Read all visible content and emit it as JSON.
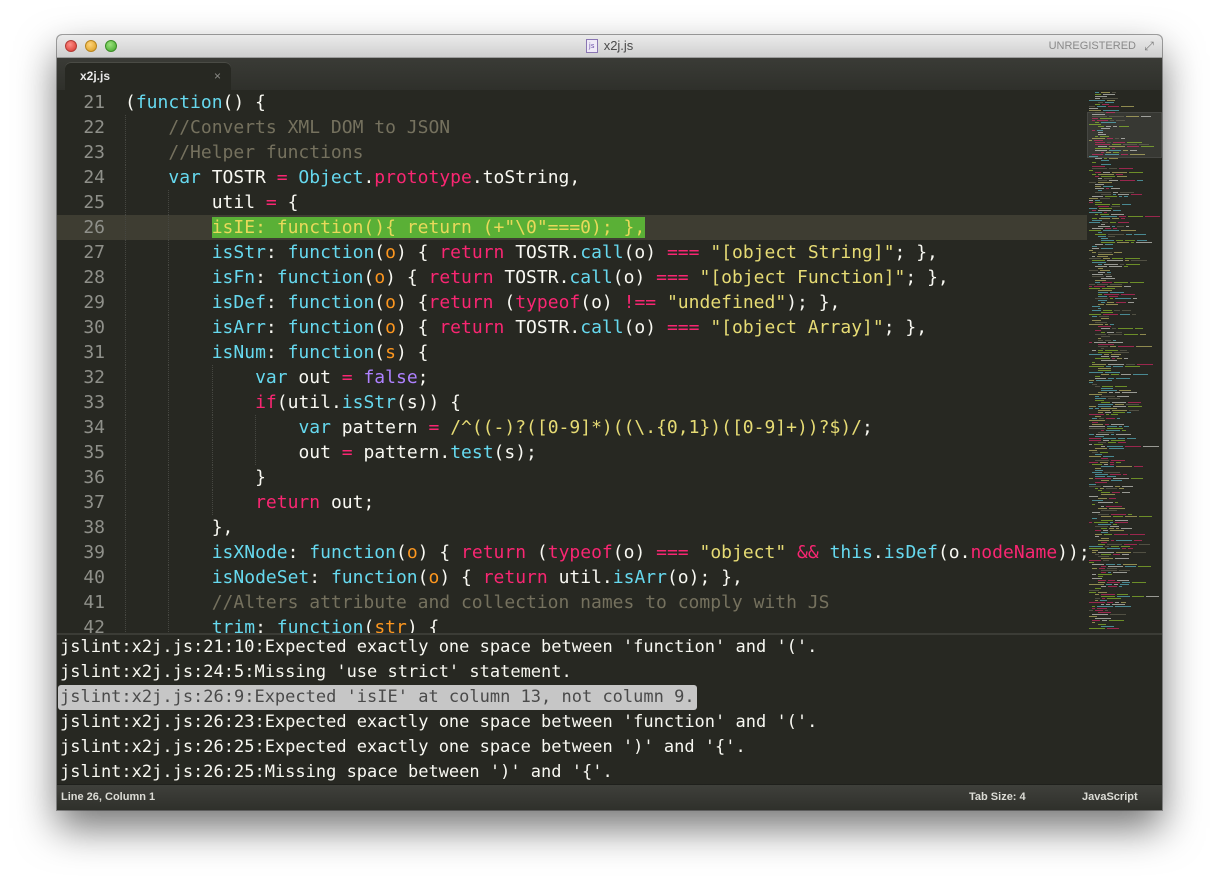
{
  "window": {
    "title": "x2j.js",
    "file_icon": "js",
    "registration": "UNREGISTERED"
  },
  "tabs": [
    {
      "label": "x2j.js",
      "close": "×"
    }
  ],
  "editor": {
    "current_line": 26,
    "lines": [
      {
        "num": "21",
        "indent": 0,
        "html": "(<span class='f'>function</span>() {"
      },
      {
        "num": "22",
        "indent": 1,
        "html": "<span class='c'>//Converts XML DOM to JSON</span>"
      },
      {
        "num": "23",
        "indent": 1,
        "html": "<span class='c'>//Helper functions</span>"
      },
      {
        "num": "24",
        "indent": 1,
        "html": "<span class='f'>var</span> TOSTR <span class='k'>=</span> <span class='f'>Object</span>.<span class='k'>prototype</span>.toString,"
      },
      {
        "num": "25",
        "indent": 2,
        "html": "util <span class='k'>=</span> {"
      },
      {
        "num": "26",
        "indent": 2,
        "html": "<span class='hl-lint'>isIE: function(){ return (+\"\\0\"===0); },</span>"
      },
      {
        "num": "27",
        "indent": 2,
        "html": "<span class='f'>isStr</span>: <span class='f'>function</span>(<span class='a'>o</span>) { <span class='k'>return</span> TOSTR.<span class='f'>call</span>(o) <span class='k'>===</span> <span class='s'>\"[object String]\"</span>; },"
      },
      {
        "num": "28",
        "indent": 2,
        "html": "<span class='f'>isFn</span>: <span class='f'>function</span>(<span class='a'>o</span>) { <span class='k'>return</span> TOSTR.<span class='f'>call</span>(o) <span class='k'>===</span> <span class='s'>\"[object Function]\"</span>; },"
      },
      {
        "num": "29",
        "indent": 2,
        "html": "<span class='f'>isDef</span>: <span class='f'>function</span>(<span class='a'>o</span>) {<span class='k'>return</span> (<span class='k'>typeof</span>(o) <span class='k'>!==</span> <span class='s'>\"undefined\"</span>); },"
      },
      {
        "num": "30",
        "indent": 2,
        "html": "<span class='f'>isArr</span>: <span class='f'>function</span>(<span class='a'>o</span>) { <span class='k'>return</span> TOSTR.<span class='f'>call</span>(o) <span class='k'>===</span> <span class='s'>\"[object Array]\"</span>; },"
      },
      {
        "num": "31",
        "indent": 2,
        "html": "<span class='f'>isNum</span>: <span class='f'>function</span>(<span class='a'>s</span>) {"
      },
      {
        "num": "32",
        "indent": 3,
        "html": "<span class='f'>var</span> out <span class='k'>=</span> <span class='n'>false</span>;"
      },
      {
        "num": "33",
        "indent": 3,
        "html": "<span class='k'>if</span>(util.<span class='f'>isStr</span>(s)) {"
      },
      {
        "num": "34",
        "indent": 4,
        "html": "<span class='f'>var</span> pattern <span class='k'>=</span> <span class='s'>/^((-)?([0-9]*)((\\.{0,1})([0-9]+))?$)/</span>;"
      },
      {
        "num": "35",
        "indent": 4,
        "html": "out <span class='k'>=</span> pattern.<span class='f'>test</span>(s);"
      },
      {
        "num": "36",
        "indent": 3,
        "html": "}"
      },
      {
        "num": "37",
        "indent": 3,
        "html": "<span class='k'>return</span> out;"
      },
      {
        "num": "38",
        "indent": 2,
        "html": "},"
      },
      {
        "num": "39",
        "indent": 2,
        "html": "<span class='f'>isXNode</span>: <span class='f'>function</span>(<span class='a'>o</span>) { <span class='k'>return</span> (<span class='k'>typeof</span>(o) <span class='k'>===</span> <span class='s'>\"object\"</span> <span class='k'>&amp;&amp;</span> <span class='f'>this</span>.<span class='f'>isDef</span>(o.<span class='k'>nodeName</span>));"
      },
      {
        "num": "40",
        "indent": 2,
        "html": "<span class='f'>isNodeSet</span>: <span class='f'>function</span>(<span class='a'>o</span>) { <span class='k'>return</span> util.<span class='f'>isArr</span>(o); },"
      },
      {
        "num": "41",
        "indent": 2,
        "html": "<span class='c'>//Alters attribute and collection names to comply with JS</span>"
      },
      {
        "num": "42",
        "indent": 2,
        "html": "<span class='f'>trim</span>: <span class='f'>function</span>(<span class='a'>str</span>) {"
      }
    ]
  },
  "output_panel": {
    "selected_index": 2,
    "lines": [
      "jslint:x2j.js:21:10:Expected exactly one space between 'function' and '('.",
      "jslint:x2j.js:24:5:Missing 'use strict' statement.",
      "jslint:x2j.js:26:9:Expected 'isIE' at column 13, not column 9.",
      "jslint:x2j.js:26:23:Expected exactly one space between 'function' and '('.",
      "jslint:x2j.js:26:25:Expected exactly one space between ')' and '{'.",
      "jslint:x2j.js:26:25:Missing space between ')' and '{'."
    ]
  },
  "status_bar": {
    "position": "Line 26, Column 1",
    "tab_size": "Tab Size: 4",
    "syntax": "JavaScript"
  },
  "theme": {
    "background": "#272822",
    "current_line": "#3e3d32",
    "lint_highlight": "#5ab036"
  }
}
